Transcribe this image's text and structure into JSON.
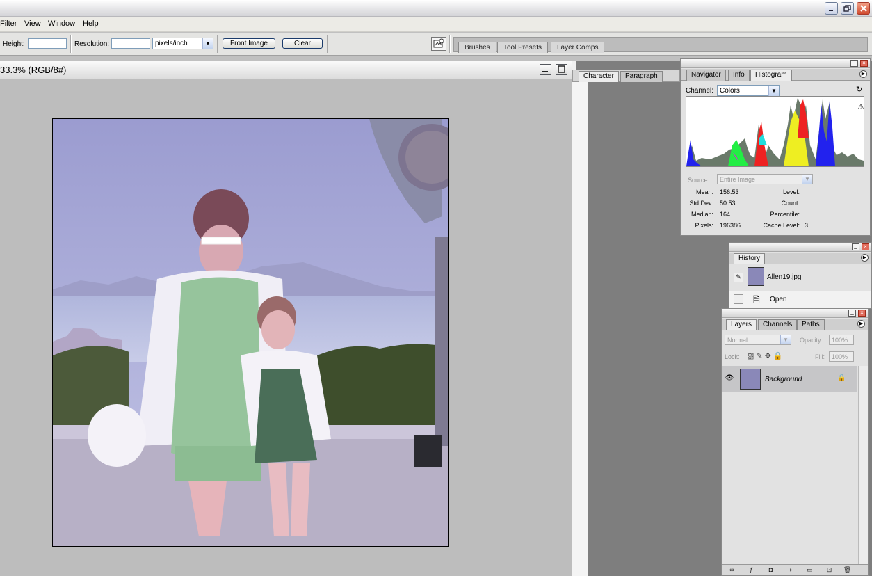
{
  "menu": {
    "items": [
      "Filter",
      "View",
      "Window",
      "Help"
    ]
  },
  "options": {
    "height_label": "Height:",
    "height_value": "",
    "resolution_label": "Resolution:",
    "resolution_value": "",
    "units": "pixels/inch",
    "front_image_label": "Front Image",
    "clear_label": "Clear"
  },
  "well": {
    "tabs": [
      "Brushes",
      "Tool Presets",
      "Layer Comps"
    ]
  },
  "document": {
    "title": "33.3% (RGB/8#)"
  },
  "char_panel": {
    "tabs": [
      "Character",
      "Paragraph"
    ]
  },
  "histogram": {
    "tabs": [
      "Navigator",
      "Info",
      "Histogram"
    ],
    "channel_label": "Channel:",
    "channel_value": "Colors",
    "source_label": "Source:",
    "source_value": "Entire Image",
    "mean_label": "Mean:",
    "mean_value": "156.53",
    "stddev_label": "Std Dev:",
    "stddev_value": "50.53",
    "median_label": "Median:",
    "median_value": "164",
    "pixels_label": "Pixels:",
    "pixels_value": "196386",
    "level_label": "Level:",
    "count_label": "Count:",
    "percentile_label": "Percentile:",
    "cache_label": "Cache Level:",
    "cache_value": "3"
  },
  "history": {
    "tab": "History",
    "snapshot_label": "Allen19.jpg",
    "open_label": "Open"
  },
  "layers": {
    "tabs": [
      "Layers",
      "Channels",
      "Paths"
    ],
    "blend_mode": "Normal",
    "opacity_label": "Opacity:",
    "opacity_value": "100%",
    "lock_label": "Lock:",
    "fill_label": "Fill:",
    "fill_value": "100%",
    "layer_name": "Background"
  },
  "colors": {
    "accent": "#1c3c6c",
    "workspace": "#7e7e7e",
    "canvas_bg": "#bdbdbd"
  }
}
